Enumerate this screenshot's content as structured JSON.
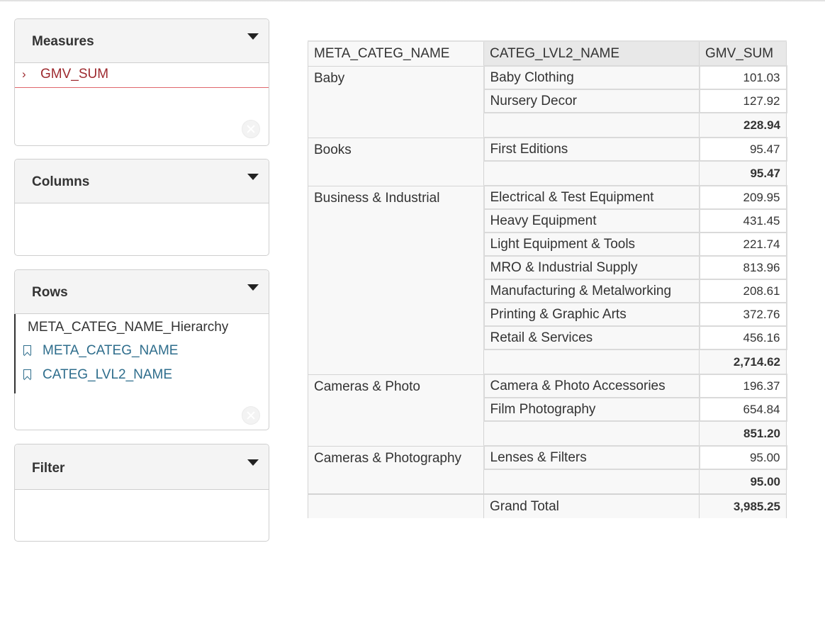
{
  "panels": {
    "measures": {
      "title": "Measures",
      "items": [
        "GMV_SUM"
      ]
    },
    "columns": {
      "title": "Columns"
    },
    "rows": {
      "title": "Rows",
      "hierarchy": "META_CATEG_NAME_Hierarchy",
      "levels": [
        "META_CATEG_NAME",
        "CATEG_LVL2_NAME"
      ]
    },
    "filter": {
      "title": "Filter"
    }
  },
  "table": {
    "headers": [
      "META_CATEG_NAME",
      "CATEG_LVL2_NAME",
      "GMV_SUM"
    ],
    "groups": [
      {
        "name": "Baby",
        "rows": [
          [
            "Baby Clothing",
            "101.03"
          ],
          [
            "Nursery Decor",
            "127.92"
          ]
        ],
        "subtotal": "228.94"
      },
      {
        "name": "Books",
        "rows": [
          [
            "First Editions",
            "95.47"
          ]
        ],
        "subtotal": "95.47"
      },
      {
        "name": "Business & Industrial",
        "rows": [
          [
            "Electrical & Test Equipment",
            "209.95"
          ],
          [
            "Heavy Equipment",
            "431.45"
          ],
          [
            "Light Equipment & Tools",
            "221.74"
          ],
          [
            "MRO & Industrial Supply",
            "813.96"
          ],
          [
            "Manufacturing & Metalworking",
            "208.61"
          ],
          [
            "Printing & Graphic Arts",
            "372.76"
          ],
          [
            "Retail & Services",
            "456.16"
          ]
        ],
        "subtotal": "2,714.62"
      },
      {
        "name": "Cameras & Photo",
        "rows": [
          [
            "Camera & Photo Accessories",
            "196.37"
          ],
          [
            "Film Photography",
            "654.84"
          ]
        ],
        "subtotal": "851.20"
      },
      {
        "name": "Cameras & Photography",
        "rows": [
          [
            "Lenses & Filters",
            "95.00"
          ]
        ],
        "subtotal": "95.00"
      }
    ],
    "grand_total_label": "Grand Total",
    "grand_total": "3,985.25"
  }
}
